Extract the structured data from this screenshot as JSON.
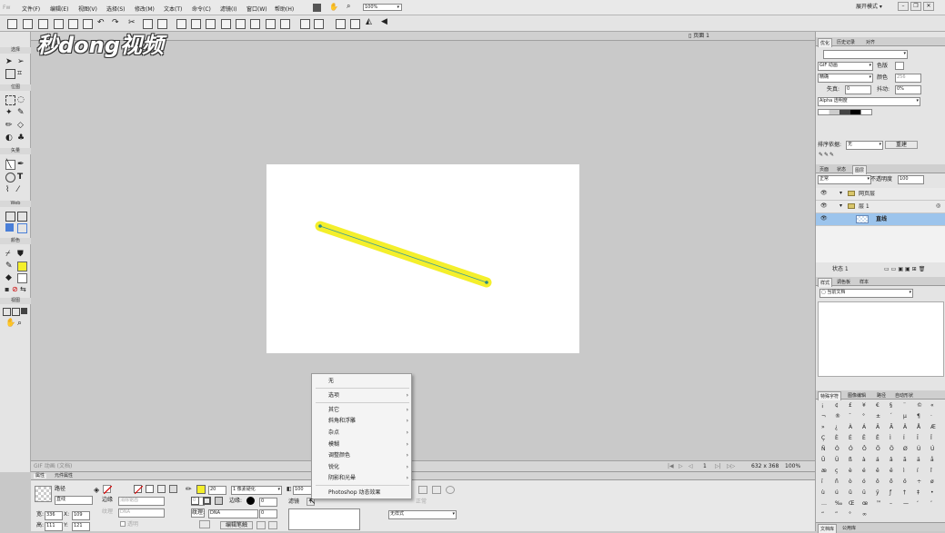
{
  "menubar": {
    "items": [
      "文件(F)",
      "编辑(E)",
      "视图(V)",
      "选择(S)",
      "修改(M)",
      "文本(T)",
      "命令(C)",
      "滤镜(I)",
      "窗口(W)",
      "帮助(H)"
    ],
    "zoom": "100%",
    "workspace": "展开模式"
  },
  "watermark": {
    "text": "秒dong视频"
  },
  "doc": {
    "page_label": "页面 1"
  },
  "tools_panel": {
    "sections": [
      "选择",
      "位图",
      "矢量",
      "Web",
      "颜色",
      "视图"
    ]
  },
  "statusbar": {
    "left_text": "GIF 动画 (文档)",
    "page_num": "1",
    "size": "632 x 368",
    "zoom": "100%"
  },
  "properties": {
    "tabs": [
      "属性",
      "元件属性"
    ],
    "object_type": "路径",
    "object_name": "直线",
    "edge_label": "边缘",
    "edge_value": "消除锯齿",
    "texture_label": "纹理",
    "texture_value": "0",
    "transparent_label": "透明",
    "w_label": "宽:",
    "w_value": "336",
    "h_label": "高:",
    "h_value": "111",
    "x_label": "X:",
    "x_value": "109",
    "y_label": "Y:",
    "y_value": "121",
    "stroke_size": "20",
    "stroke_type": "1 像素硬化",
    "stroke_edge_label": "边缘:",
    "stroke_edge_value": "0",
    "stroke_texture_label": "纹理:",
    "stroke_texture_value": "0",
    "texture_name": "DNA",
    "edit_stroke": "编辑笔触",
    "opacity": "100",
    "filter_label": "滤镜",
    "style_value": "无样式",
    "normal_label": "正常"
  },
  "context_menu": {
    "items": [
      {
        "label": "无",
        "submenu": false
      },
      {
        "label": "选项",
        "submenu": true
      },
      {
        "label": "其它",
        "submenu": true
      },
      {
        "label": "斜角和浮雕",
        "submenu": true
      },
      {
        "label": "杂点",
        "submenu": true
      },
      {
        "label": "模糊",
        "submenu": true
      },
      {
        "label": "调整颜色",
        "submenu": true
      },
      {
        "label": "锐化",
        "submenu": true
      },
      {
        "label": "阴影和光晕",
        "submenu": true
      },
      {
        "label": "Photoshop 动态效果",
        "submenu": false
      }
    ]
  },
  "optimize_panel": {
    "tabs": [
      "优化",
      "历史记录",
      "对齐"
    ],
    "format": "GIF 动画",
    "matte_label": "色版",
    "palette": "精确",
    "colors_label": "颜色",
    "colors_value": "256",
    "loss_label": "失真:",
    "loss_value": "0",
    "dither_label": "抖动:",
    "dither_value": "0%",
    "alpha": "Alpha 透明度",
    "sort_label": "排序依据:",
    "sort_value": "无",
    "rebuild": "重建"
  },
  "layers_panel": {
    "tabs": [
      "页面",
      "状态",
      "图层"
    ],
    "blend": "正常",
    "opacity_label": "不透明度",
    "opacity_value": "100",
    "rows": [
      "网页层",
      "层 1",
      "直线"
    ],
    "state_label": "状态 1"
  },
  "styles_panel": {
    "tabs": [
      "样式",
      "调色板",
      "样本"
    ],
    "current": "当前文档"
  },
  "chars_panel": {
    "tabs": [
      "特殊字符",
      "图像编辑",
      "路径",
      "自动形状"
    ],
    "chars": [
      "¡",
      "¢",
      "£",
      "¥",
      "€",
      "§",
      "¨",
      "©",
      "«",
      "¬",
      "®",
      "¯",
      "°",
      "±",
      "´",
      "µ",
      "¶",
      "·",
      "»",
      "¿",
      "À",
      "Á",
      "Â",
      "Ã",
      "Ä",
      "Å",
      "Æ",
      "Ç",
      "È",
      "É",
      "Ê",
      "Ë",
      "Ì",
      "Í",
      "Î",
      "Ï",
      "Ñ",
      "Ò",
      "Ó",
      "Ô",
      "Õ",
      "Ö",
      "Ø",
      "Ù",
      "Ú",
      "Û",
      "Ü",
      "ß",
      "à",
      "á",
      "â",
      "ã",
      "ä",
      "å",
      "æ",
      "ç",
      "è",
      "é",
      "ê",
      "ë",
      "ì",
      "í",
      "î",
      "ï",
      "ñ",
      "ò",
      "ó",
      "ô",
      "õ",
      "ö",
      "÷",
      "ø",
      "ù",
      "ú",
      "û",
      "ü",
      "ÿ",
      "ƒ",
      "†",
      "‡",
      "•",
      "…",
      "‰",
      "Œ",
      "œ",
      "™",
      "–",
      "—",
      "‘",
      "’",
      "“",
      "”",
      "°",
      "∞"
    ],
    "bottom_tabs": [
      "文档库",
      "公用库"
    ]
  },
  "colors": {
    "stroke": "#f4ef2b",
    "line_center": "#3a9a9a",
    "selection": "#9cc4ec",
    "canvas": "#ffffff"
  }
}
